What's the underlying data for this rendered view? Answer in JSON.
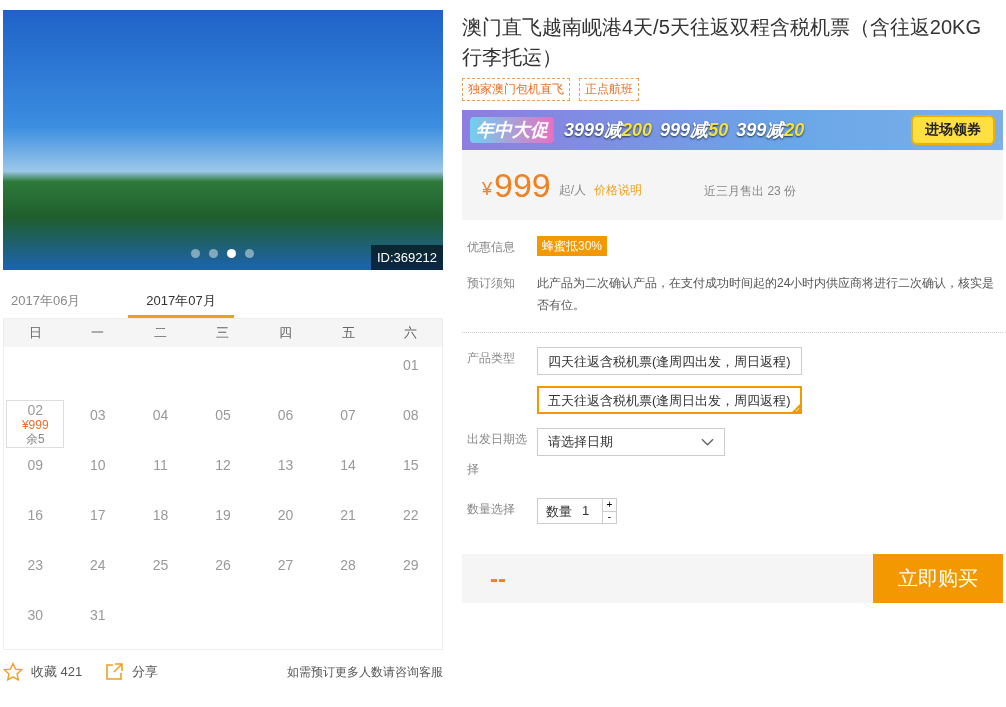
{
  "gallery": {
    "id_badge": "ID:369212",
    "dots": [
      {
        "selected": false
      },
      {
        "selected": false
      },
      {
        "selected": true
      },
      {
        "selected": false
      }
    ]
  },
  "calendar": {
    "tabs": [
      {
        "label": "2017年06月",
        "selected": false
      },
      {
        "label": "2017年07月",
        "selected": true
      }
    ],
    "weekdays": [
      "日",
      "一",
      "二",
      "三",
      "四",
      "五",
      "六"
    ],
    "weeks": [
      [
        {
          "day": "01",
          "selected": false
        }
      ],
      [
        {
          "day": "02",
          "price": "¥999",
          "remaining": "余5",
          "selected": true
        },
        {
          "day": "03",
          "selected": false
        },
        {
          "day": "04",
          "selected": false
        },
        {
          "day": "05",
          "selected": false
        },
        {
          "day": "06",
          "selected": false
        },
        {
          "day": "07",
          "selected": false
        },
        {
          "day": "08",
          "selected": false
        }
      ],
      [
        {
          "day": "09",
          "selected": false
        },
        {
          "day": "10",
          "selected": false
        },
        {
          "day": "11",
          "selected": false
        },
        {
          "day": "12",
          "selected": false
        },
        {
          "day": "13",
          "selected": false
        },
        {
          "day": "14",
          "selected": false
        },
        {
          "day": "15",
          "selected": false
        }
      ],
      [
        {
          "day": "16",
          "selected": false
        },
        {
          "day": "17",
          "selected": false
        },
        {
          "day": "18",
          "selected": false
        },
        {
          "day": "19",
          "selected": false
        },
        {
          "day": "20",
          "selected": false
        },
        {
          "day": "21",
          "selected": false
        },
        {
          "day": "22",
          "selected": false
        }
      ],
      [
        {
          "day": "23",
          "selected": false
        },
        {
          "day": "24",
          "selected": false
        },
        {
          "day": "25",
          "selected": false
        },
        {
          "day": "26",
          "selected": false
        },
        {
          "day": "27",
          "selected": false
        },
        {
          "day": "28",
          "selected": false
        },
        {
          "day": "29",
          "selected": false
        }
      ],
      [
        {
          "day": "30",
          "selected": false
        },
        {
          "day": "31",
          "selected": false
        }
      ]
    ]
  },
  "footer": {
    "favorite": "收藏 421",
    "share": "分享",
    "note": "如需预订更多人数请咨询客服"
  },
  "product": {
    "title": "澳门直飞越南岘港4天/5天往返双程含税机票（含往返20KG行李托运）",
    "tags": [
      "独家澳门包机直飞",
      "正点航班"
    ],
    "banner": {
      "headline": "年中大促",
      "offers": [
        {
          "amount": "3999",
          "word": "减",
          "discount": "200"
        },
        {
          "amount": "999",
          "word": "减",
          "discount": "50"
        },
        {
          "amount": "399",
          "word": "减",
          "discount": "20"
        }
      ],
      "button": "进场领券"
    },
    "price": {
      "currency": "¥",
      "amount": "999",
      "unit": "起/人",
      "link": "价格说明",
      "sales": "近三月售出 23 份"
    },
    "discount": {
      "label": "优惠信息",
      "badge": "蜂蜜抵30%"
    },
    "notice": {
      "label": "预订须知",
      "text": "此产品为二次确认产品，在支付成功时间起的24小时内供应商将进行二次确认，核实是否有位。"
    },
    "type": {
      "label": "产品类型",
      "options": [
        {
          "label": "四天往返含税机票(逢周四出发，周日返程)",
          "selected": false
        },
        {
          "label": "五天往返含税机票(逢周日出发，周四返程)",
          "selected": true
        }
      ]
    },
    "date": {
      "label": "出发日期选择",
      "placeholder": "请选择日期"
    },
    "quantity": {
      "label": "数量选择",
      "prefix": "数量",
      "value": "1",
      "plus": "+",
      "minus": "-"
    },
    "total": "--",
    "buy": "立即购买"
  }
}
